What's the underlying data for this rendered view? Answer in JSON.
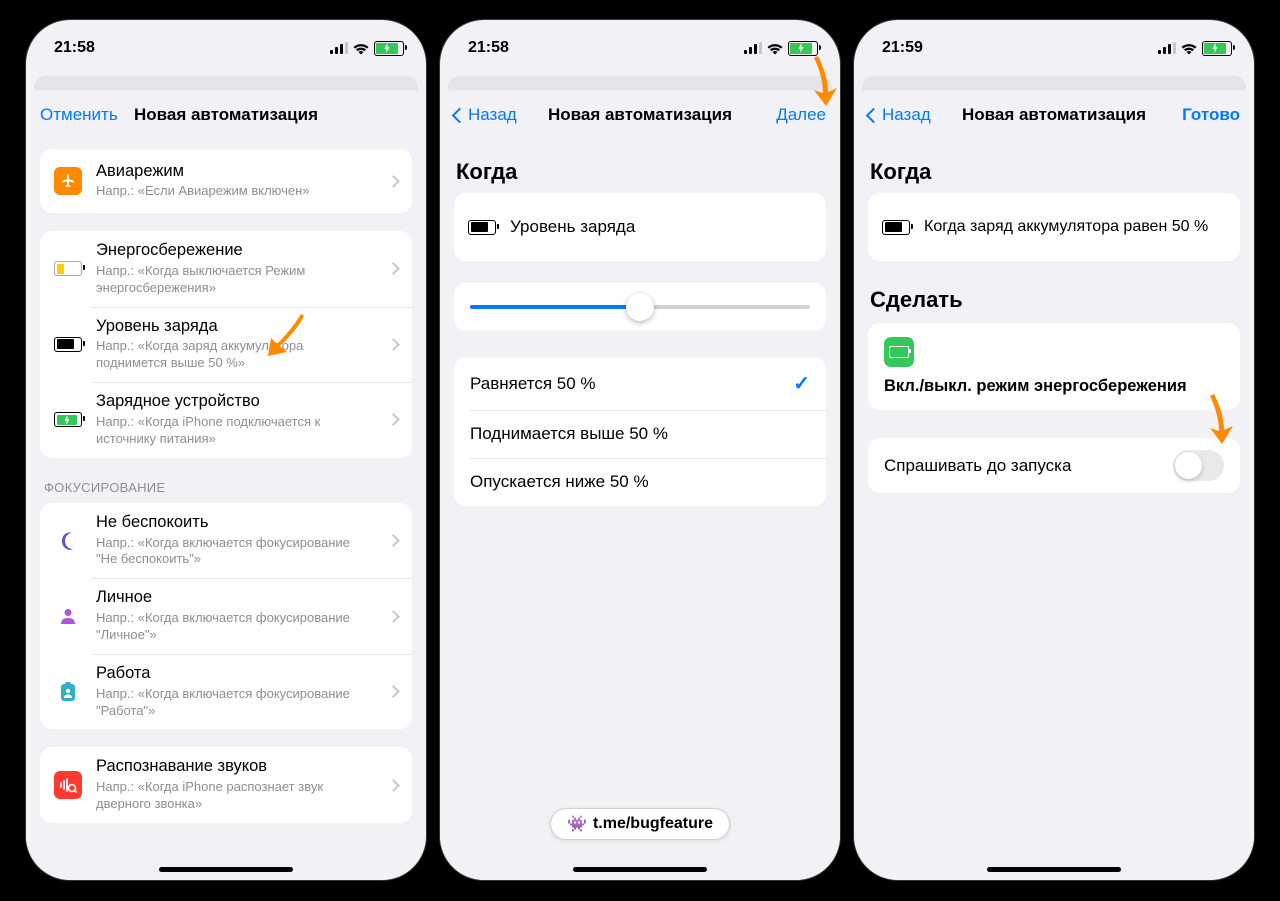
{
  "screens": [
    {
      "time": "21:58",
      "nav": {
        "left": "Отменить",
        "title": "Новая автоматизация",
        "right": ""
      },
      "list": {
        "airplane": {
          "title": "Авиарежим",
          "sub": "Напр.: «Если Авиарежим включен»"
        },
        "lowpower": {
          "title": "Энергосбережение",
          "sub": "Напр.: «Когда выключается Режим энергосбережения»"
        },
        "battery": {
          "title": "Уровень заряда",
          "sub": "Напр.: «Когда заряд аккумулятора поднимется выше 50 %»"
        },
        "charger": {
          "title": "Зарядное устройство",
          "sub": "Напр.: «Когда iPhone подключается к источнику питания»"
        },
        "focus_header": "ФОКУСИРОВАНИЕ",
        "dnd": {
          "title": "Не беспокоить",
          "sub": "Напр.: «Когда включается фокусирование \"Не беспокоить\"»"
        },
        "personal": {
          "title": "Личное",
          "sub": "Напр.: «Когда включается фокусирование \"Личное\"»"
        },
        "work": {
          "title": "Работа",
          "sub": "Напр.: «Когда включается фокусирование \"Работа\"»"
        },
        "sound": {
          "title": "Распознавание звуков",
          "sub": "Напр.: «Когда iPhone распознает звук дверного звонка»"
        }
      }
    },
    {
      "time": "21:58",
      "nav": {
        "left": "Назад",
        "title": "Новая автоматизация",
        "right": "Далее"
      },
      "when_heading": "Когда",
      "when_row": "Уровень заряда",
      "options": {
        "eq": "Равняется 50 %",
        "gt": "Поднимается выше 50 %",
        "lt": "Опускается ниже 50 %"
      }
    },
    {
      "time": "21:59",
      "nav": {
        "left": "Назад",
        "title": "Новая автоматизация",
        "right": "Готово"
      },
      "when_heading": "Когда",
      "when_row": "Когда заряд аккумулятора равен 50 %",
      "do_heading": "Сделать",
      "action_title": "Вкл./выкл. режим энергосбережения",
      "ask_label": "Спрашивать до запуска"
    }
  ],
  "watermark": {
    "prefix": "t.me/bug",
    "bold": "feature"
  }
}
